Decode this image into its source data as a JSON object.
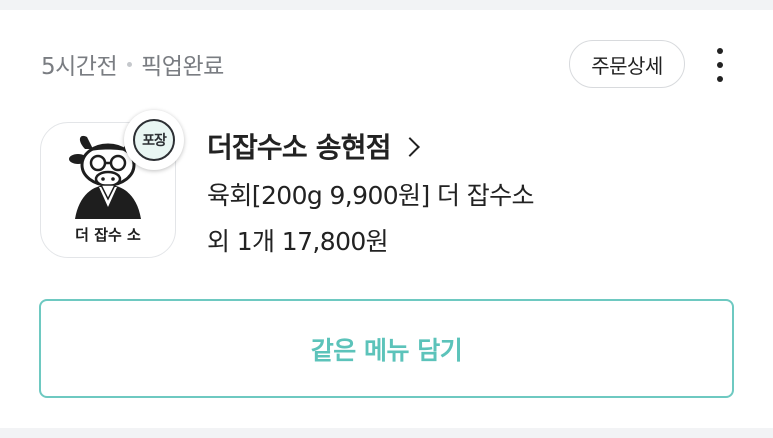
{
  "order": {
    "time_ago": "5시간전",
    "status": "픽업완료",
    "detail_button_label": "주문상세",
    "more_icon": "more-vertical-icon",
    "store": {
      "name": "더잡수소 송현점",
      "logo_text": "더 잡수 소",
      "badge_label": "포장"
    },
    "menu_summary_line1": "육회[200g 9,900원] 더 잡수소",
    "menu_summary_line2": "외 1개 17,800원",
    "reorder_button_label": "같은 메뉴 담기"
  },
  "colors": {
    "accent": "#5cc3ba",
    "accent_border": "#6ec9c1",
    "meta_text": "#7a7d82",
    "badge_bg": "#e9f6f3",
    "divider": "#f2f3f5"
  }
}
